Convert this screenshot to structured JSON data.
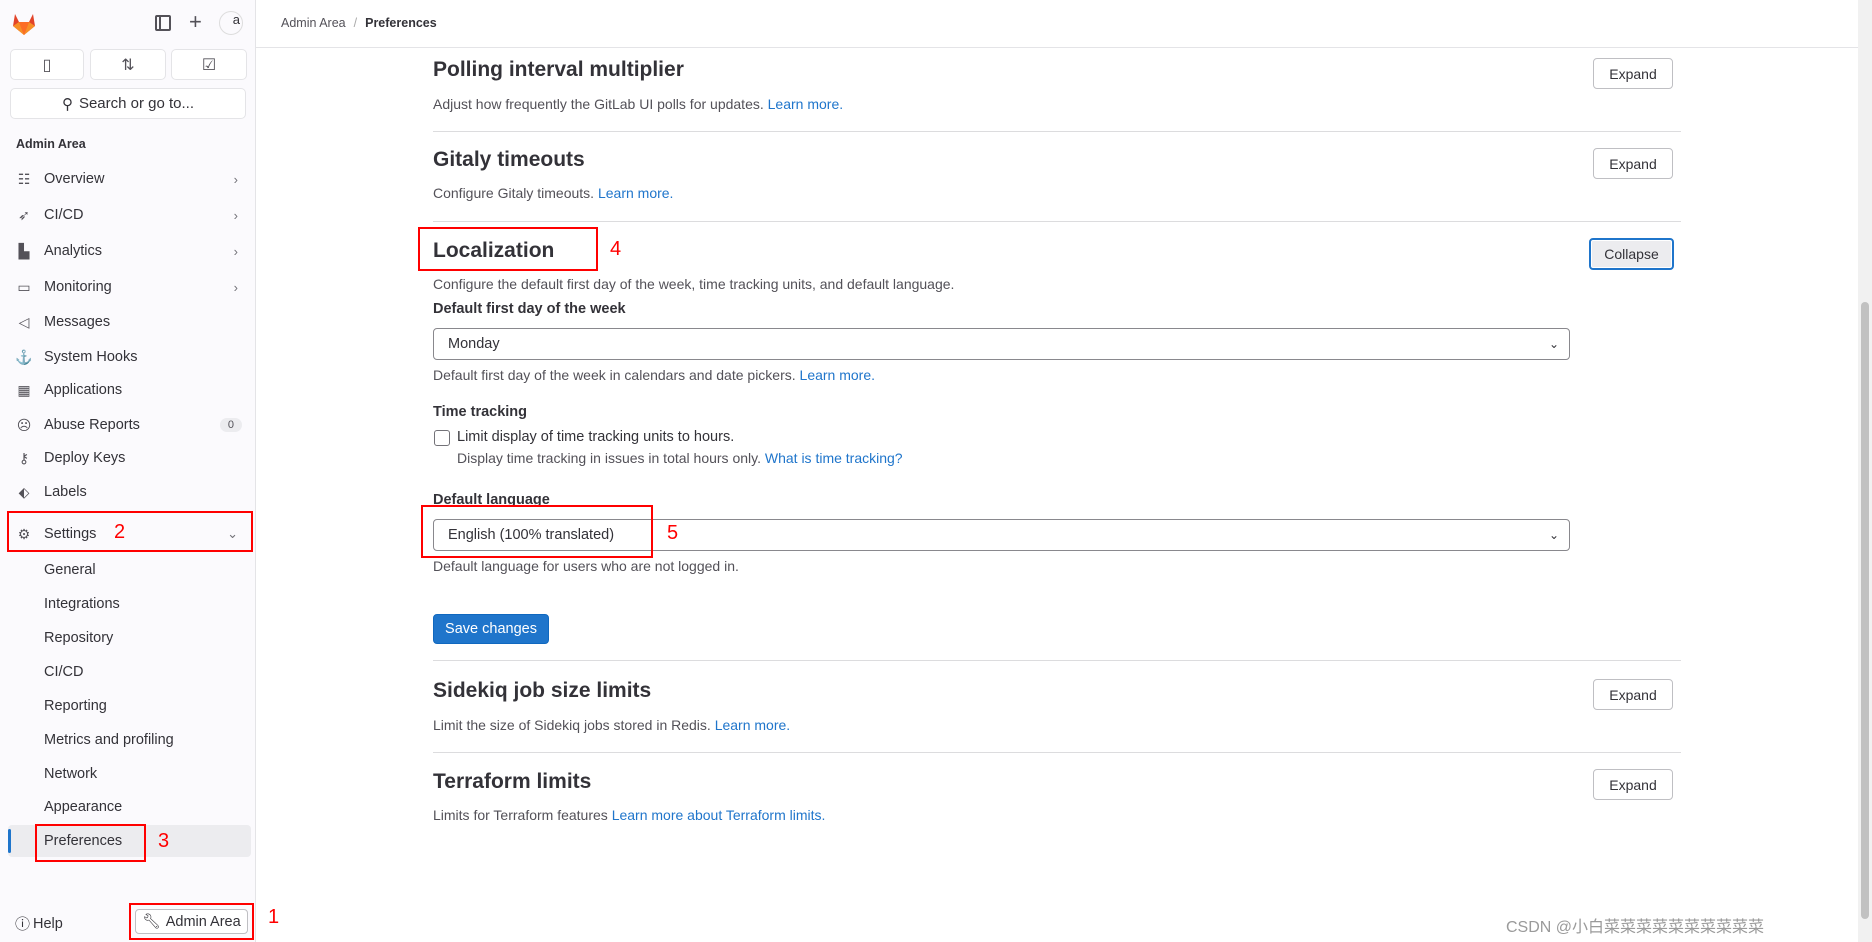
{
  "header": {
    "breadcrumb": [
      "Admin Area",
      "Preferences"
    ],
    "separator": "/"
  },
  "sidebar": {
    "avatar_alt": "a",
    "search_label": "Search or go to...",
    "section_title": "Admin Area",
    "items": [
      {
        "label": "Overview",
        "icon": "overview-icon",
        "chevron": true
      },
      {
        "label": "CI/CD",
        "icon": "rocket-icon",
        "chevron": true
      },
      {
        "label": "Analytics",
        "icon": "chart-icon",
        "chevron": true
      },
      {
        "label": "Monitoring",
        "icon": "monitor-icon",
        "chevron": true
      },
      {
        "label": "Messages",
        "icon": "megaphone-icon"
      },
      {
        "label": "System Hooks",
        "icon": "anchor-icon"
      },
      {
        "label": "Applications",
        "icon": "grid-icon"
      },
      {
        "label": "Abuse Reports",
        "icon": "face-icon",
        "badge": "0"
      },
      {
        "label": "Deploy Keys",
        "icon": "key-icon"
      },
      {
        "label": "Labels",
        "icon": "label-icon"
      }
    ],
    "settings": {
      "label": "Settings",
      "sub": [
        "General",
        "Integrations",
        "Repository",
        "CI/CD",
        "Reporting",
        "Metrics and profiling",
        "Network",
        "Appearance",
        "Preferences"
      ]
    },
    "help": "Help",
    "admin_area_button": "Admin Area"
  },
  "annotations": {
    "n1": "1",
    "n2": "2",
    "n3": "3",
    "n4": "4",
    "n5": "5"
  },
  "main": {
    "polling": {
      "title": "Polling interval multiplier",
      "desc": "Adjust how frequently the GitLab UI polls for updates.",
      "link": "Learn more.",
      "button": "Expand"
    },
    "gitaly": {
      "title": "Gitaly timeouts",
      "desc": "Configure Gitaly timeouts.",
      "link": "Learn more.",
      "button": "Expand"
    },
    "localization": {
      "title": "Localization",
      "desc": "Configure the default first day of the week, time tracking units, and default language.",
      "button": "Collapse",
      "first_day_label": "Default first day of the week",
      "first_day_value": "Monday",
      "first_day_help": "Default first day of the week in calendars and date pickers.",
      "first_day_link": "Learn more.",
      "time_tracking_label": "Time tracking",
      "checkbox_label": "Limit display of time tracking units to hours.",
      "checkbox_checked": false,
      "checkbox_help": "Display time tracking in issues in total hours only.",
      "checkbox_link": "What is time tracking?",
      "language_label": "Default language",
      "language_value": "English (100% translated)",
      "language_help": "Default language for users who are not logged in.",
      "save": "Save changes"
    },
    "sidekiq": {
      "title": "Sidekiq job size limits",
      "desc": "Limit the size of Sidekiq jobs stored in Redis.",
      "link": "Learn more.",
      "button": "Expand"
    },
    "terraform": {
      "title": "Terraform limits",
      "desc": "Limits for Terraform features",
      "link": "Learn more about Terraform limits.",
      "button": "Expand"
    }
  },
  "watermark": "CSDN @小白菜菜菜菜菜菜菜菜菜菜",
  "colors": {
    "accent": "#1f75cb",
    "annotation": "#ff0000"
  }
}
